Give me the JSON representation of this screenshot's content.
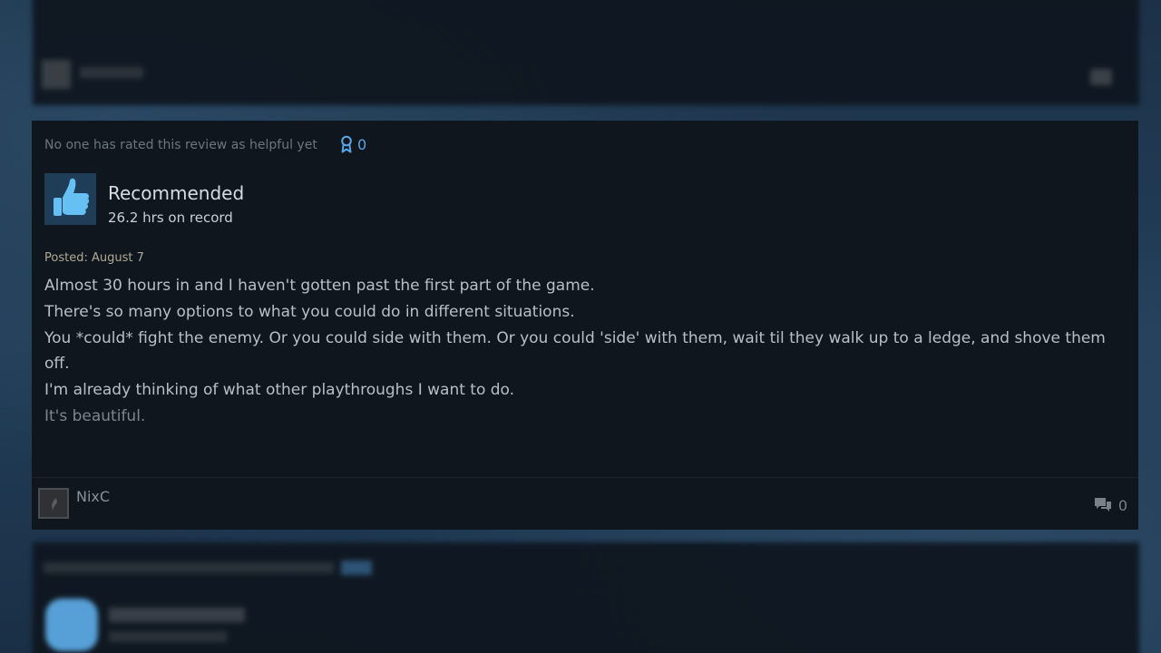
{
  "review": {
    "helpful_text": "No one has rated this review as helpful yet",
    "award_count": "0",
    "recommendation": "Recommended",
    "hours": "26.2 hrs on record",
    "posted": "Posted: August 7",
    "body": [
      "Almost 30 hours in and I haven't gotten past the first part of the game.",
      "There's so many options to what you could do in different situations.",
      "You *could* fight the enemy. Or you could side with them. Or you could 'side' with them, wait til they walk up to a ledge, and shove them off.",
      "I'm already thinking of what other playthroughs I want to do.",
      "It's beautiful."
    ],
    "author": "NixC",
    "comment_count": "0"
  },
  "icons": {
    "award": "award-icon",
    "thumbs_up": "thumbs-up-icon",
    "comment": "comment-icon",
    "avatar": "avatar"
  },
  "colors": {
    "accent_blue": "#5ba4e5",
    "thumb_blue": "#66c0f4",
    "card_bg": "#0f161e",
    "posted_text": "#b0aa92"
  }
}
